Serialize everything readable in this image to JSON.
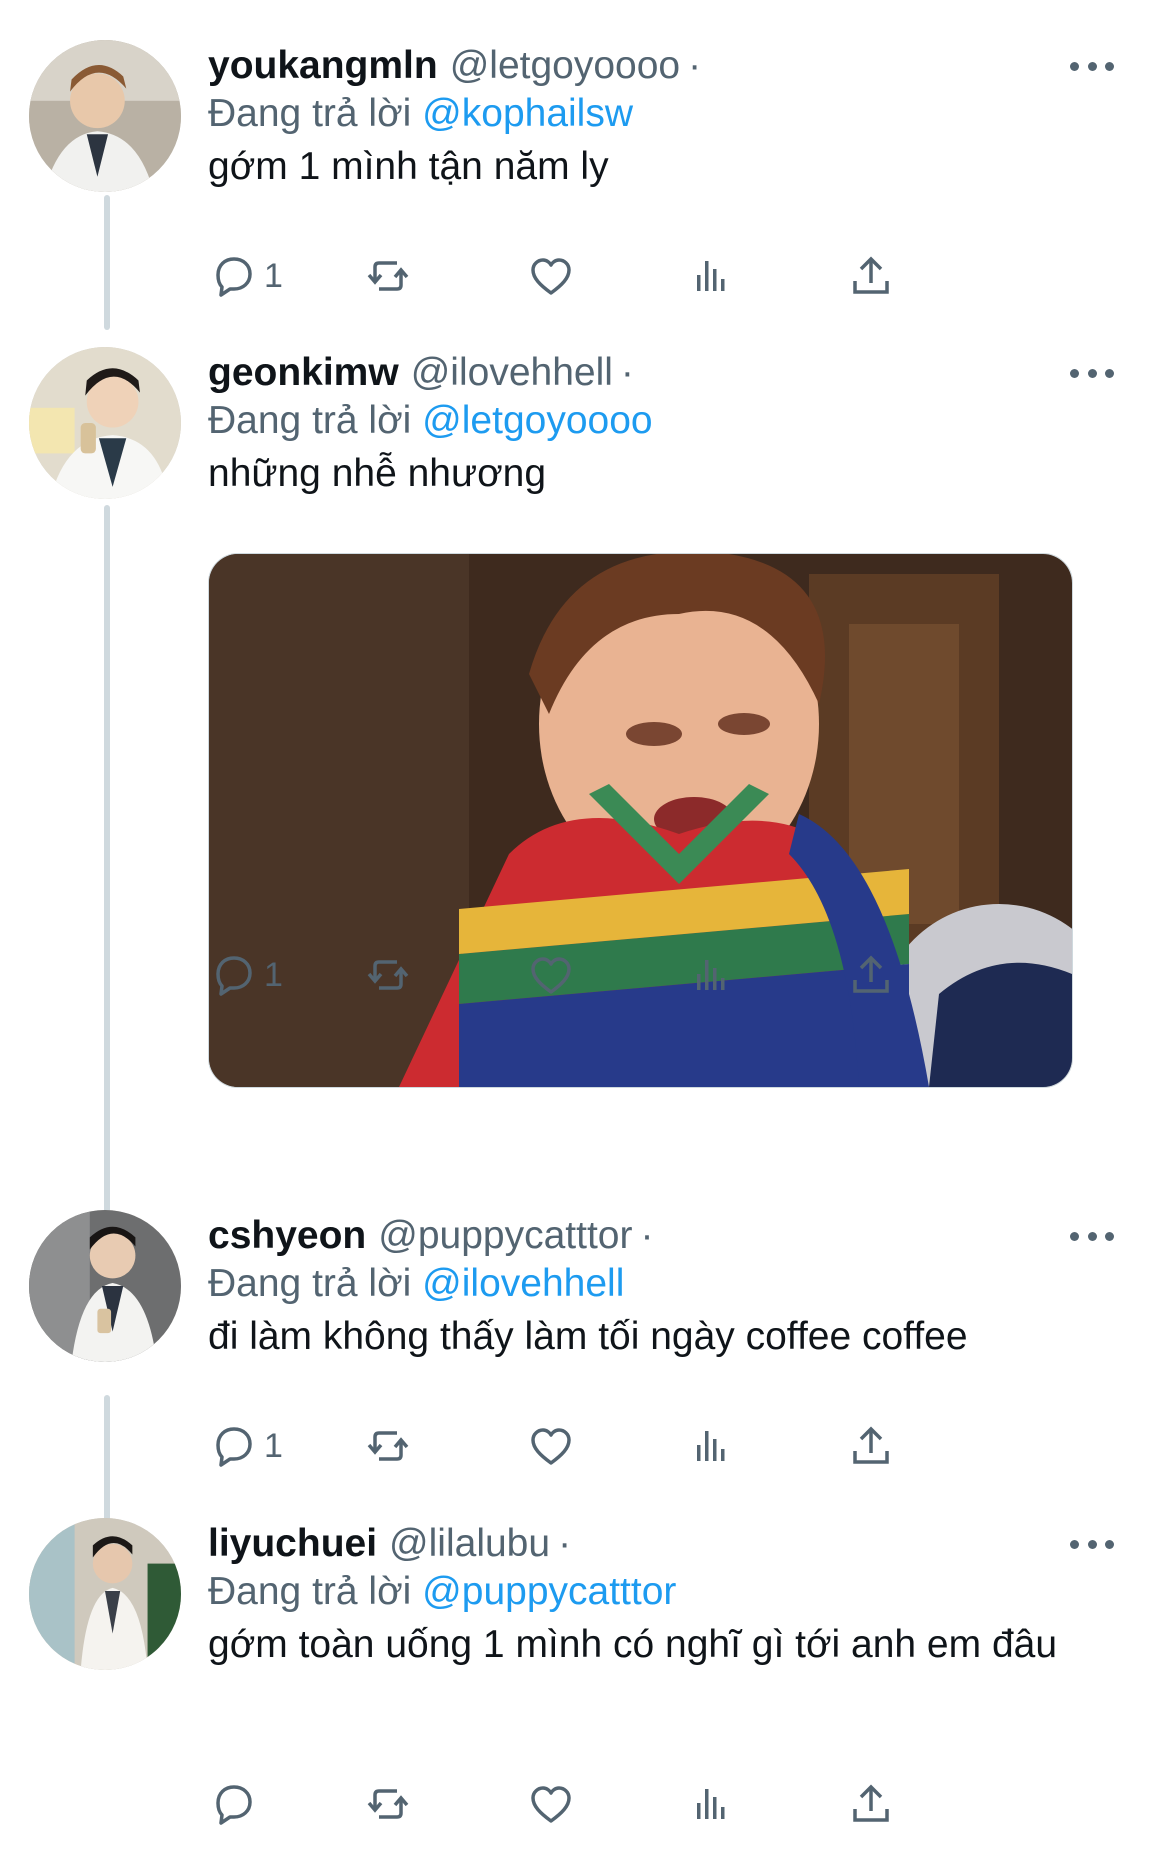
{
  "tweets": [
    {
      "name": "youkangmln",
      "handle": "@letgoyoooo",
      "dot": "·",
      "reply_prefix": "Đang trả lời",
      "reply_to": "@kophailsw",
      "text": "gớm 1 mình tận năm ly",
      "reply_count": "1"
    },
    {
      "name": "geonkimw",
      "handle": "@ilovehhell",
      "dot": "·",
      "reply_prefix": "Đang trả lời",
      "reply_to": "@letgoyoooo",
      "text": "những nhễ nhương",
      "reply_count": "1"
    },
    {
      "name": "cshyeon",
      "handle": "@puppycatttor",
      "dot": "·",
      "reply_prefix": "Đang trả lời",
      "reply_to": "@ilovehhell",
      "text": "đi làm không thấy làm tối ngày coffee coffee",
      "reply_count": "1"
    },
    {
      "name": "liyuchuei",
      "handle": "@lilalubu",
      "dot": "·",
      "reply_prefix": "Đang trả lời",
      "reply_to": "@puppycatttor",
      "text": "gớm toàn uống 1 mình có nghĩ gì tới anh em đâu",
      "reply_count": ""
    }
  ],
  "icons": {
    "reply": "reply-icon",
    "retweet": "retweet-icon",
    "like": "heart-icon",
    "views": "views-icon",
    "share": "share-icon",
    "more": "more-icon"
  },
  "colors": {
    "link": "#1d9bf0",
    "secondary_text": "#536471",
    "thread_line": "#cfd9de"
  }
}
